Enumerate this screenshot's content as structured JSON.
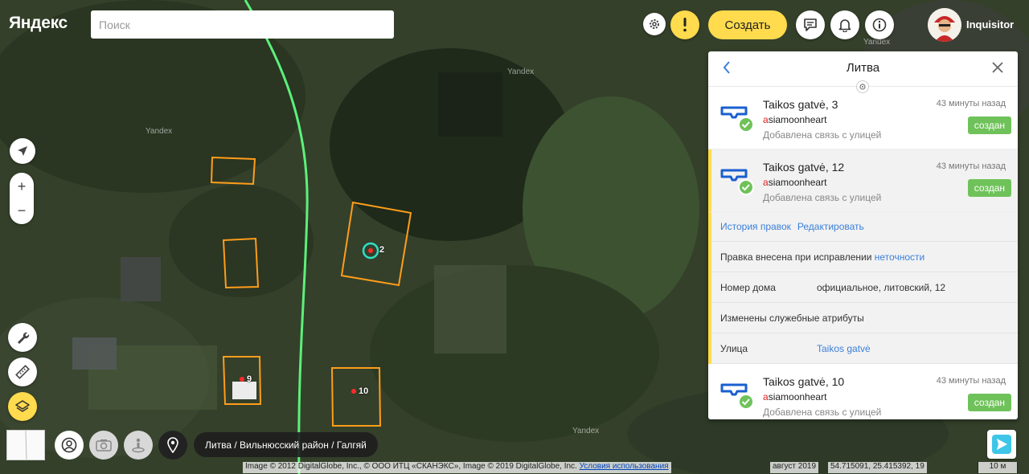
{
  "topbar": {
    "logo": "Яндекс",
    "search_placeholder": "Поиск",
    "create_label": "Создать",
    "username": "Inquisitor"
  },
  "map": {
    "watermark": "Yandex",
    "houses": [
      {
        "label": "2"
      },
      {
        "label": "9"
      },
      {
        "label": "10"
      }
    ],
    "breadcrumb": "Литва / Вильнюсский район / Галгяй",
    "copyright": "Image © 2012 DigitalGlobe, Inc., © ООО ИТЦ «СКАНЭКС», Image © 2019 DigitalGlobe, Inc.",
    "terms_link": "Условия использования",
    "image_date": "август 2019",
    "coordinates": "54.715091, 25.415392, 19",
    "scale": "10 м"
  },
  "panel": {
    "title": "Литва",
    "edits": [
      {
        "title": "Taikos gatvė, 3",
        "author_first": "a",
        "author_rest": "siamoonheart",
        "description": "Добавлена связь с улицей",
        "time": "43 минуты назад",
        "status": "создан"
      },
      {
        "title": "Taikos gatvė, 12",
        "author_first": "a",
        "author_rest": "siamoonheart",
        "description": "Добавлена связь с улицей",
        "time": "43 минуты назад",
        "status": "создан"
      },
      {
        "title": "Taikos gatvė, 10",
        "author_first": "a",
        "author_rest": "siamoonheart",
        "description": "Добавлена связь с улицей",
        "time": "43 минуты назад",
        "status": "создан"
      }
    ],
    "detail": {
      "history_link": "История правок",
      "edit_link": "Редактировать",
      "fix_text": "Правка внесена при исправлении",
      "fix_link": "неточности",
      "house_number_label": "Номер дома",
      "house_number_value": "официальное, литовский, 12",
      "service_attrs": "Изменены служебные атрибуты",
      "street_label": "Улица",
      "street_value": "Taikos gatvė"
    }
  },
  "colors": {
    "accent_yellow": "#ffdb4d",
    "status_green": "#6fc25a",
    "link_blue": "#3b7fd9",
    "building_outline": "#ff9d1a",
    "road_green": "#5cf07a"
  }
}
